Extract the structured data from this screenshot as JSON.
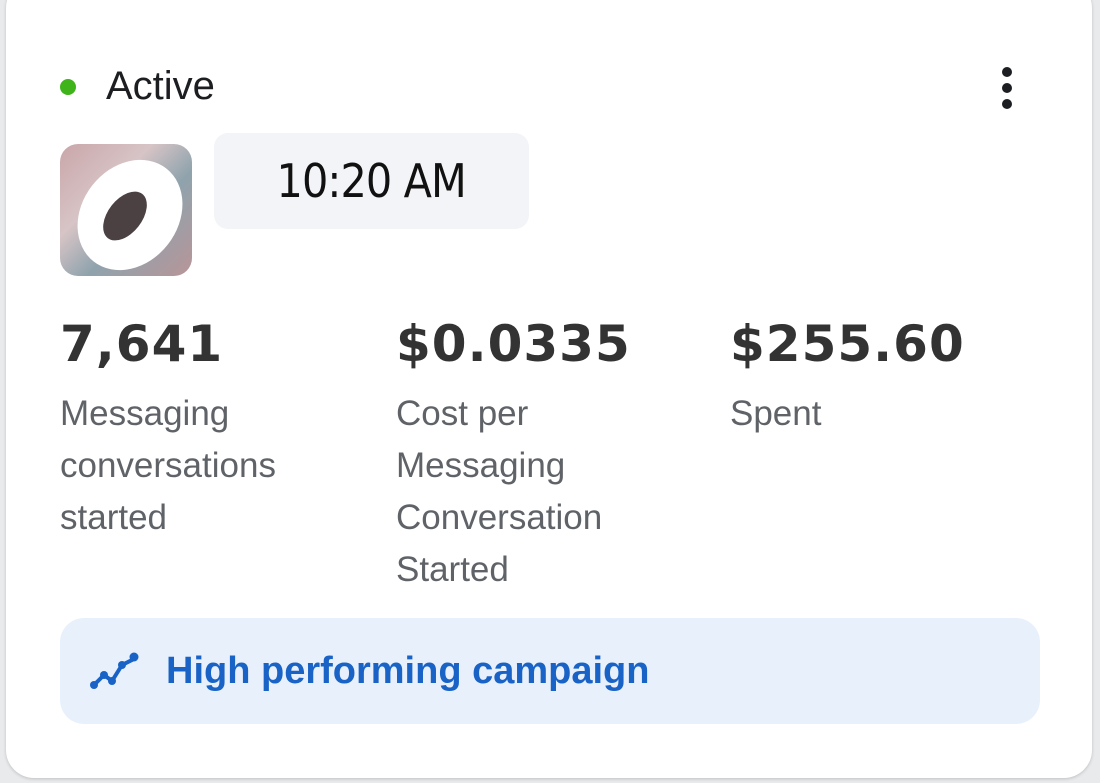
{
  "status": {
    "label": "Active",
    "dot_color": "#3fb31a",
    "menu_icon": "more-vertical-icon"
  },
  "campaign": {
    "time": "10:20 AM"
  },
  "metrics": [
    {
      "value": "7,641",
      "label": "Messaging conversations started"
    },
    {
      "value": "$0.0335",
      "label": "Cost per Messaging Conversation Started"
    },
    {
      "value": "$255.60",
      "label": "Spent"
    }
  ],
  "banner": {
    "icon": "trend-up-icon",
    "text": "High performing campaign",
    "text_color": "#1a63c6",
    "background": "#e8f1fb"
  }
}
